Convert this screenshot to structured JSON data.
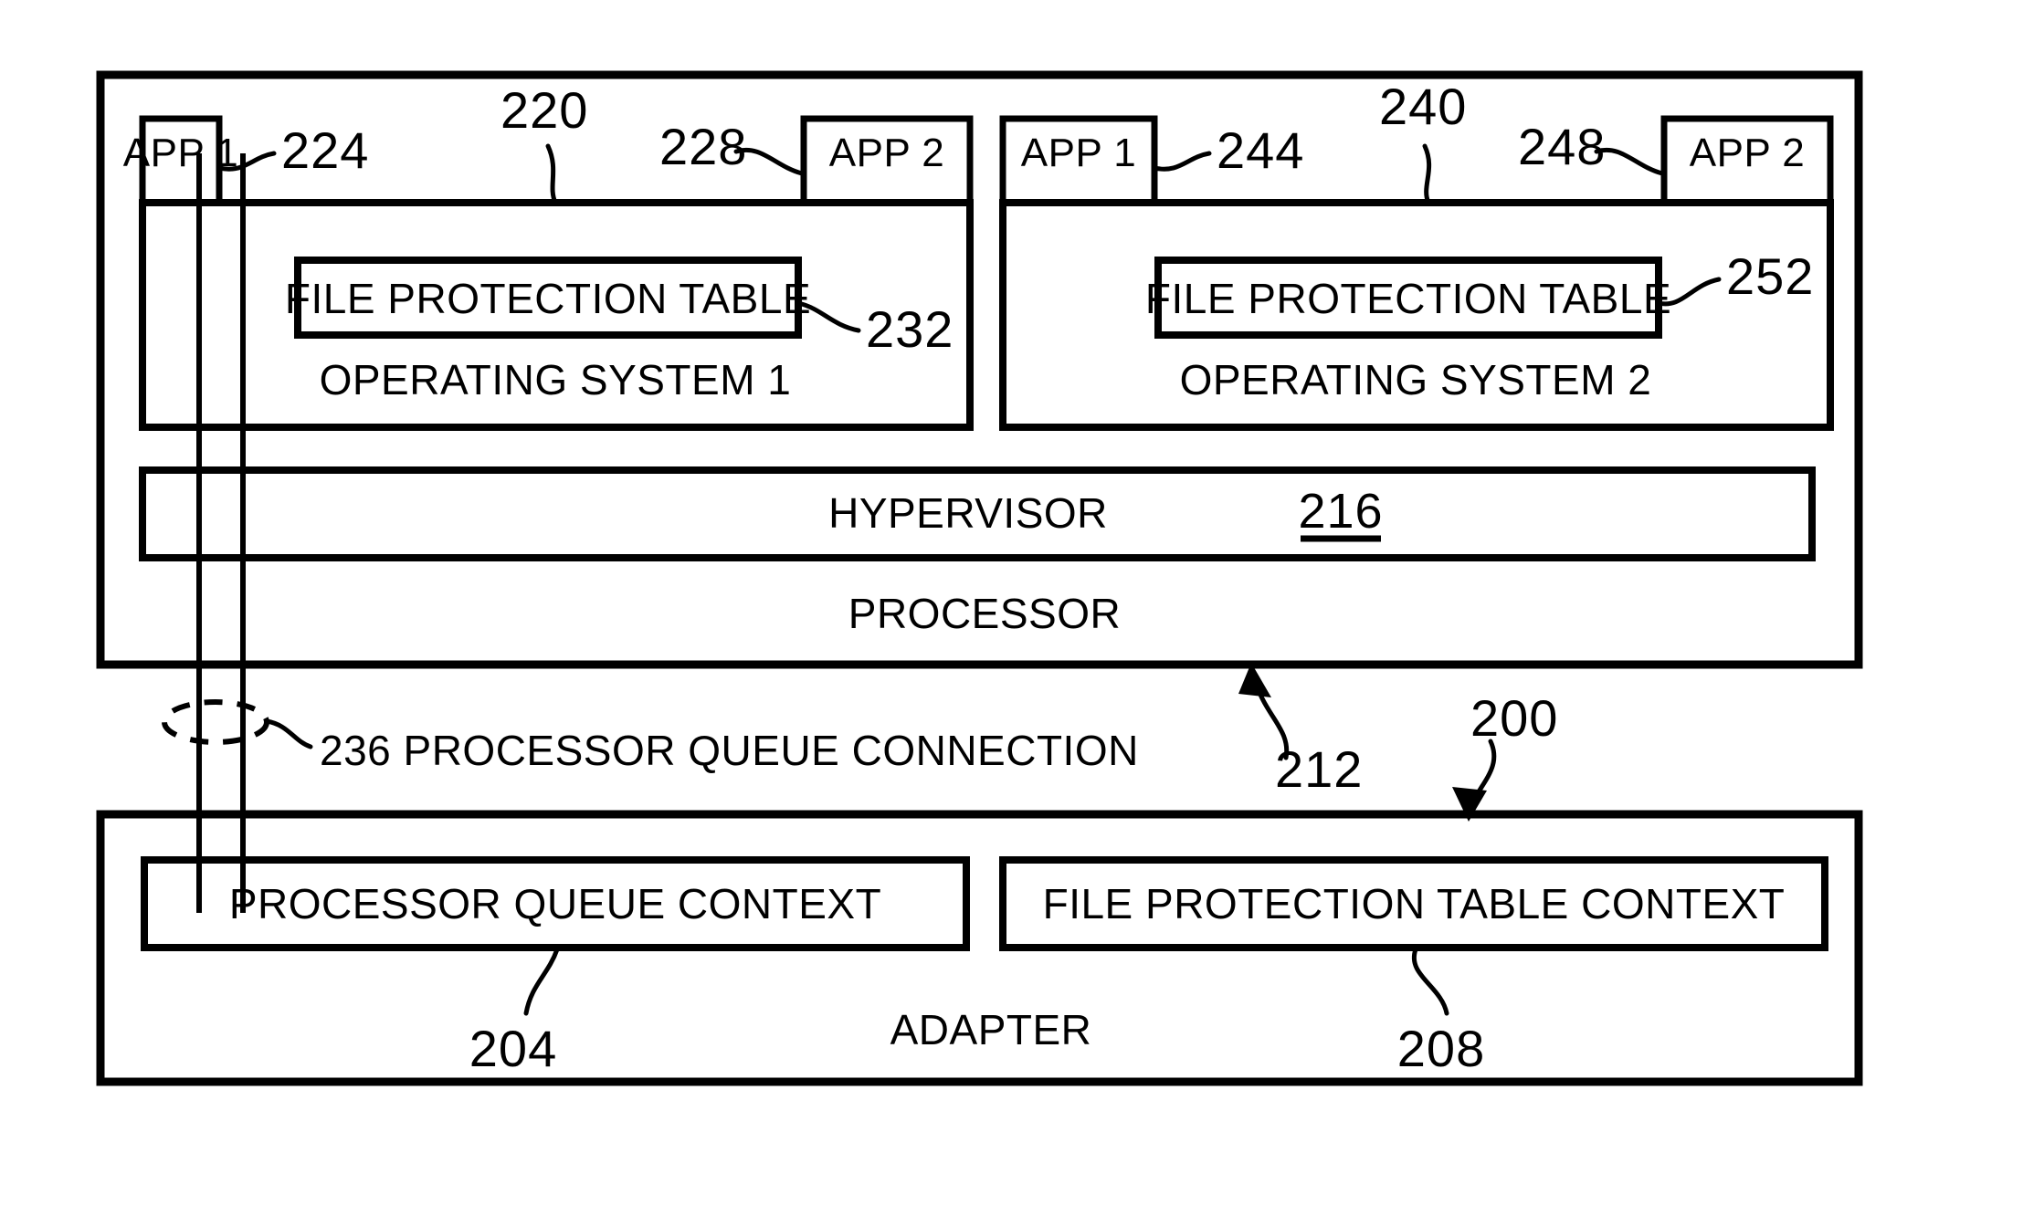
{
  "figure": {
    "type": "patent-block-diagram",
    "background_color": "#ffffff",
    "line_color": "#000000"
  },
  "processor_system": {
    "label": "PROCESSOR",
    "ref": "212",
    "system_ref": "200",
    "hypervisor": {
      "label": "HYPERVISOR",
      "ref": "216"
    },
    "os_blocks": [
      {
        "label": "OPERATING SYSTEM 1",
        "ref": "220",
        "file_protection_table": {
          "label": "FILE PROTECTION TABLE",
          "ref": "232"
        },
        "apps": [
          {
            "label": "APP 1",
            "ref": "224"
          },
          {
            "label": "APP 2",
            "ref": "228"
          }
        ]
      },
      {
        "label": "OPERATING SYSTEM 2",
        "ref": "240",
        "file_protection_table": {
          "label": "FILE PROTECTION TABLE",
          "ref": "252"
        },
        "apps": [
          {
            "label": "APP 1",
            "ref": "244"
          },
          {
            "label": "APP 2",
            "ref": "248"
          }
        ]
      }
    ]
  },
  "connection": {
    "ref": "236",
    "label": "PROCESSOR QUEUE CONNECTION",
    "combined_text": "236 PROCESSOR QUEUE CONNECTION"
  },
  "adapter": {
    "label": "ADAPTER",
    "ref": "200",
    "contexts": [
      {
        "label": "PROCESSOR QUEUE CONTEXT",
        "ref": "204"
      },
      {
        "label": "FILE PROTECTION TABLE CONTEXT",
        "ref": "208"
      }
    ]
  }
}
